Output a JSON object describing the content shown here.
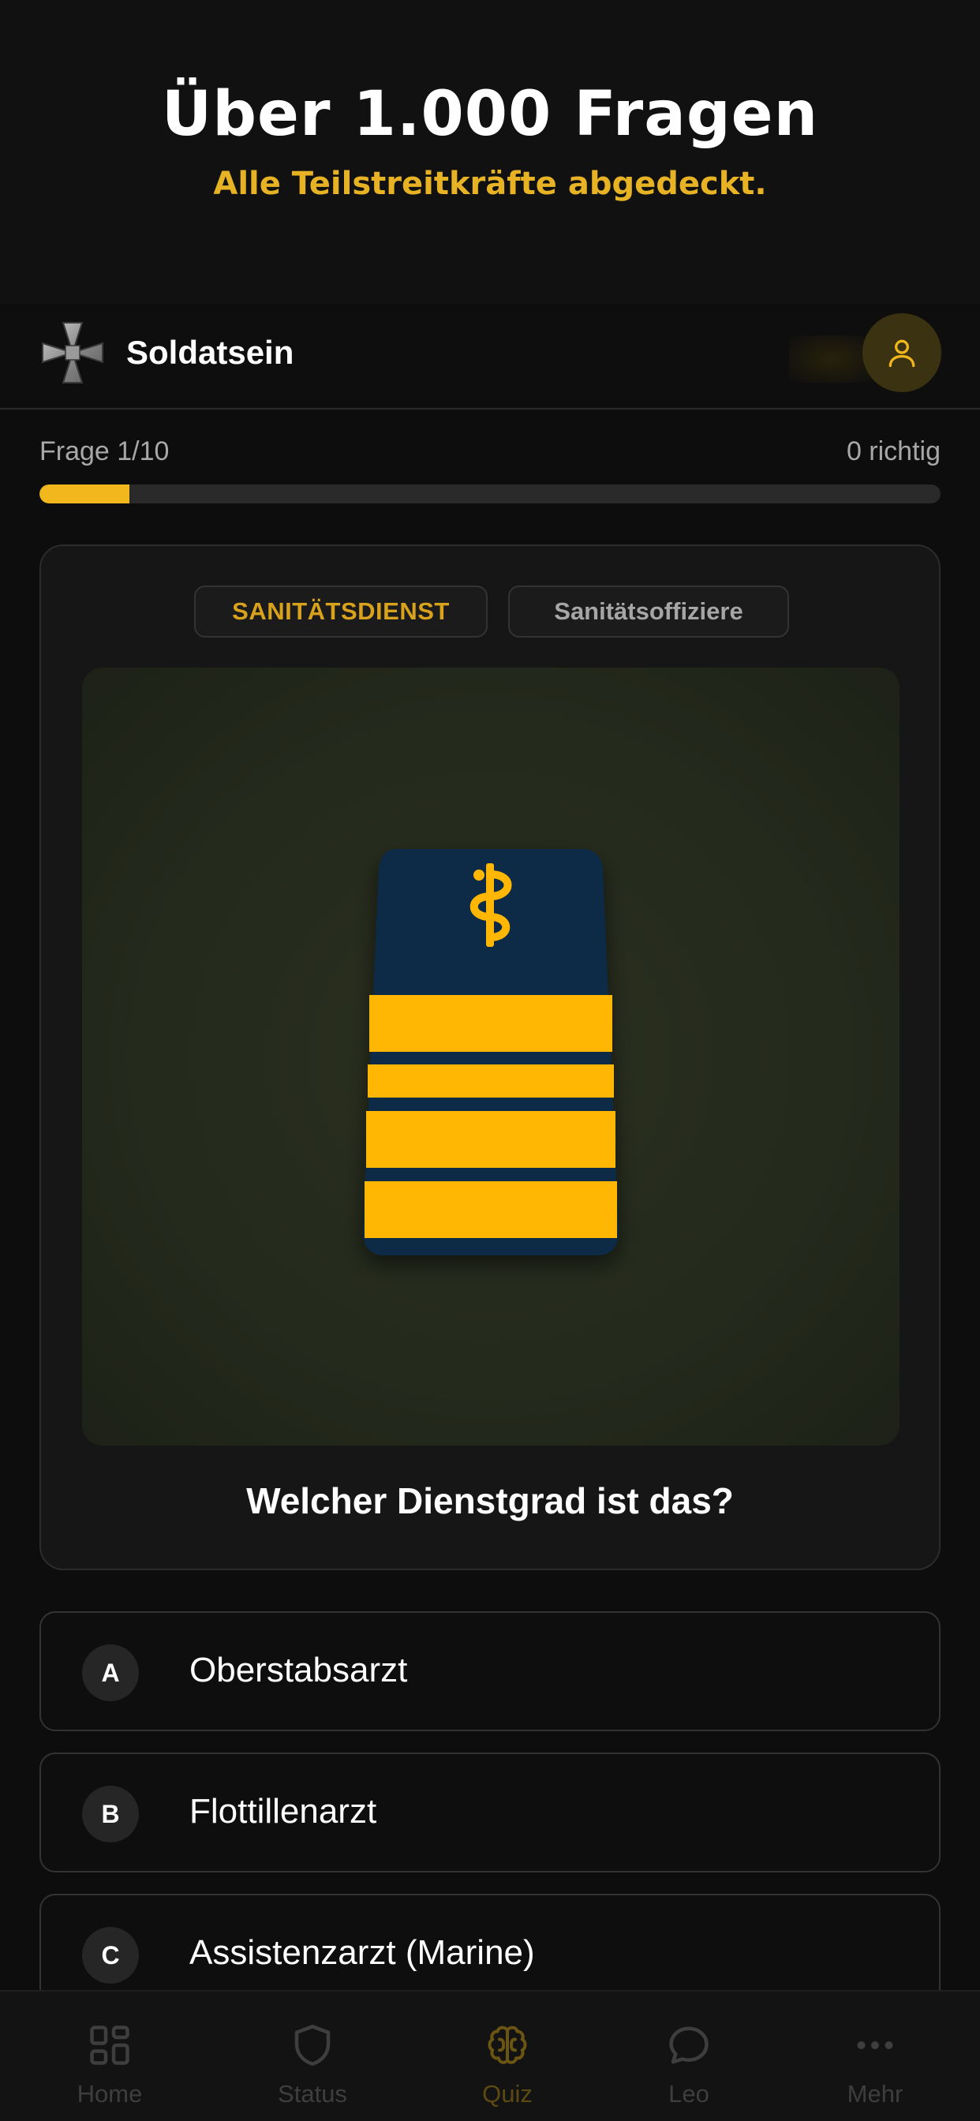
{
  "promo": {
    "title": "Über 1.000 Fragen",
    "subtitle": "Alle Teilstreitkräfte abgedeckt."
  },
  "header": {
    "app_name": "Soldatsein",
    "logo_icon": "iron-cross-icon",
    "profile_icon": "user-icon"
  },
  "quiz": {
    "progress_label": "Frage 1/10",
    "score_label": "0 richtig",
    "progress_fraction": 0.1,
    "category_tag": "SANITÄTSDIENST",
    "subcategory_tag": "Sanitätsoffiziere",
    "question": "Welcher Dienstgrad ist das?",
    "insignia": {
      "type": "shoulder-board",
      "emblem": "aesculapian-staff-icon",
      "stripes": 4,
      "base_color": "#0a2a47",
      "stripe_color": "#ffb703"
    }
  },
  "answers": [
    {
      "letter": "A",
      "text": "Oberstabsarzt"
    },
    {
      "letter": "B",
      "text": "Flottillenarzt"
    },
    {
      "letter": "C",
      "text": "Assistenzarzt (Marine)"
    }
  ],
  "tabbar": {
    "items": [
      {
        "label": "Home",
        "icon": "grid-icon",
        "active": false
      },
      {
        "label": "Status",
        "icon": "shield-icon",
        "active": false
      },
      {
        "label": "Quiz",
        "icon": "brain-icon",
        "active": true
      },
      {
        "label": "Leo",
        "icon": "chat-bubble-icon",
        "active": false
      },
      {
        "label": "Mehr",
        "icon": "more-dots-icon",
        "active": false
      }
    ]
  },
  "colors": {
    "accent": "#f2b71c",
    "background": "#0d0d0d",
    "card": "#161616"
  }
}
